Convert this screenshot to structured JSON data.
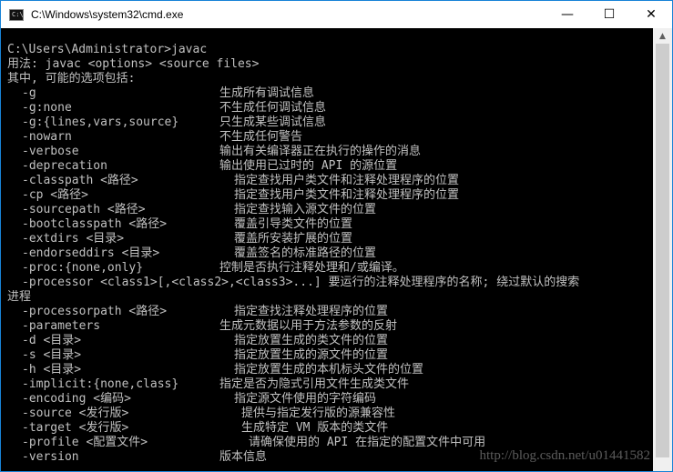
{
  "window": {
    "title": "C:\\Windows\\system32\\cmd.exe",
    "controls": {
      "minimize": "—",
      "maximize": "☐",
      "close": "✕"
    },
    "icon_text": "C:\\"
  },
  "console": {
    "prompt_line": "C:\\Users\\Administrator>javac",
    "usage_line": "用法: javac <options> <source files>",
    "options_header": "其中, 可能的选项包括:",
    "options": [
      {
        "flag": "-g",
        "desc": "生成所有调试信息",
        "indent": 0
      },
      {
        "flag": "-g:none",
        "desc": "不生成任何调试信息",
        "indent": 0
      },
      {
        "flag": "-g:{lines,vars,source}",
        "desc": "只生成某些调试信息",
        "indent": 0
      },
      {
        "flag": "-nowarn",
        "desc": "不生成任何警告",
        "indent": 0
      },
      {
        "flag": "-verbose",
        "desc": "输出有关编译器正在执行的操作的消息",
        "indent": 0
      },
      {
        "flag": "-deprecation",
        "desc": "输出使用已过时的 API 的源位置",
        "indent": 0
      },
      {
        "flag": "-classpath <路径>",
        "desc": "指定查找用户类文件和注释处理程序的位置",
        "indent": 1
      },
      {
        "flag": "-cp <路径>",
        "desc": "指定查找用户类文件和注释处理程序的位置",
        "indent": 1
      },
      {
        "flag": "-sourcepath <路径>",
        "desc": "指定查找输入源文件的位置",
        "indent": 1
      },
      {
        "flag": "-bootclasspath <路径>",
        "desc": "覆盖引导类文件的位置",
        "indent": 1
      },
      {
        "flag": "-extdirs <目录>",
        "desc": "覆盖所安装扩展的位置",
        "indent": 1
      },
      {
        "flag": "-endorseddirs <目录>",
        "desc": "覆盖签名的标准路径的位置",
        "indent": 1
      },
      {
        "flag": "-proc:{none,only}",
        "desc": "控制是否执行注释处理和/或编译。",
        "indent": 0
      }
    ],
    "processor_line": "-processor <class1>[,<class2>,<class3>...] 要运行的注释处理程序的名称; 绕过默认的搜索",
    "processor_wrap": "进程",
    "options2": [
      {
        "flag": "-processorpath <路径>",
        "desc": "指定查找注释处理程序的位置",
        "indent": 1
      },
      {
        "flag": "-parameters",
        "desc": "生成元数据以用于方法参数的反射",
        "indent": 0
      },
      {
        "flag": "-d <目录>",
        "desc": "指定放置生成的类文件的位置",
        "indent": 1
      },
      {
        "flag": "-s <目录>",
        "desc": "指定放置生成的源文件的位置",
        "indent": 1
      },
      {
        "flag": "-h <目录>",
        "desc": "指定放置生成的本机标头文件的位置",
        "indent": 1
      },
      {
        "flag": "-implicit:{none,class}",
        "desc": "指定是否为隐式引用文件生成类文件",
        "indent": 0
      },
      {
        "flag": "-encoding <编码>",
        "desc": "指定源文件使用的字符编码",
        "indent": 1
      },
      {
        "flag": "-source <发行版>",
        "desc": "提供与指定发行版的源兼容性",
        "indent": 2
      },
      {
        "flag": "-target <发行版>",
        "desc": "生成特定 VM 版本的类文件",
        "indent": 2
      },
      {
        "flag": "-profile <配置文件>",
        "desc": "请确保使用的 API 在指定的配置文件中可用",
        "indent": 3
      },
      {
        "flag": "-version",
        "desc": "版本信息",
        "indent": 0
      }
    ]
  },
  "watermark": "http://blog.csdn.net/u01441582",
  "colors": {
    "console_bg": "#000000",
    "console_text": "#c0c0c0",
    "titlebar_bg": "#ffffff",
    "border": "#1883d7"
  }
}
